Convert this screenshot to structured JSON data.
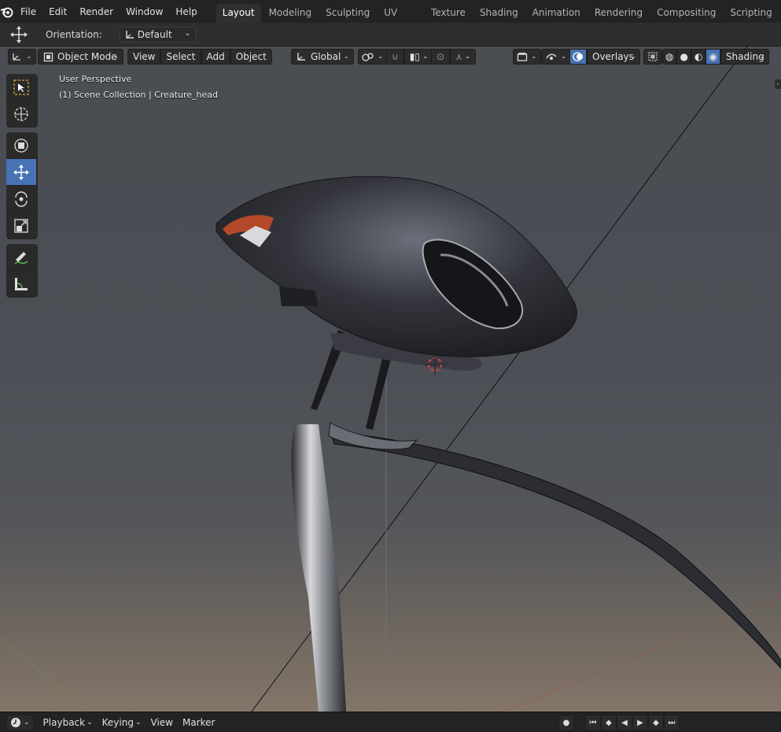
{
  "menubar": {
    "items": [
      "File",
      "Edit",
      "Render",
      "Window",
      "Help"
    ]
  },
  "workspaces": {
    "tabs": [
      "Layout",
      "Modeling",
      "Sculpting",
      "UV Editing",
      "Texture Paint",
      "Shading",
      "Animation",
      "Rendering",
      "Compositing",
      "Scripting"
    ],
    "active": "Layout",
    "add_label": "+"
  },
  "tool_settings": {
    "orientation_label": "Orientation:",
    "orientation_value": "Default"
  },
  "viewport_header": {
    "mode": "Object Mode",
    "view": "View",
    "select": "Select",
    "add": "Add",
    "object": "Object",
    "transform_orientation": "Global",
    "overlays": "Overlays",
    "shading": "Shading"
  },
  "viewport": {
    "perspective_label": "User Perspective",
    "collection_label": "(1) Scene Collection | Creature_head"
  },
  "timeline": {
    "playback": "Playback",
    "keying": "Keying",
    "view": "View",
    "marker": "Marker"
  },
  "colors": {
    "accent": "#4772b3",
    "background": "#1d1d1d",
    "header": "#232323"
  }
}
